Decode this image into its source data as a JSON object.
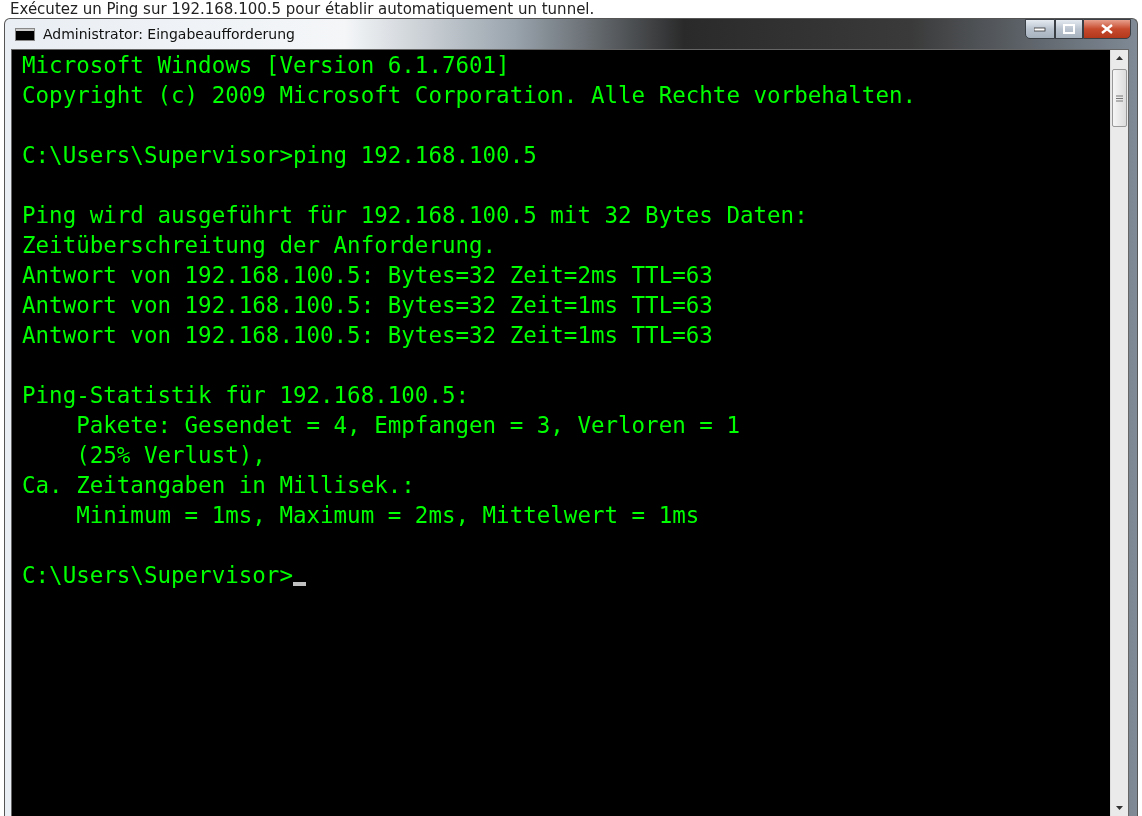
{
  "caption": "Exécutez un Ping sur 192.168.100.5 pour établir automatiquement un tunnel.",
  "window": {
    "title": "Administrator: Eingabeaufforderung",
    "controls": [
      {
        "kind": "minimize"
      },
      {
        "kind": "maximize"
      },
      {
        "kind": "close"
      }
    ]
  },
  "console": {
    "blocks": [
      [
        "Microsoft Windows [Version 6.1.7601]",
        "Copyright (c) 2009 Microsoft Corporation. Alle Rechte vorbehalten."
      ],
      [
        "C:\\Users\\Supervisor>ping 192.168.100.5"
      ],
      [
        "Ping wird ausgeführt für 192.168.100.5 mit 32 Bytes Daten:",
        "Zeitüberschreitung der Anforderung.",
        "Antwort von 192.168.100.5: Bytes=32 Zeit=2ms TTL=63",
        "Antwort von 192.168.100.5: Bytes=32 Zeit=1ms TTL=63",
        "Antwort von 192.168.100.5: Bytes=32 Zeit=1ms TTL=63"
      ],
      [
        "Ping-Statistik für 192.168.100.5:",
        "    Pakete: Gesendet = 4, Empfangen = 3, Verloren = 1",
        "    (25% Verlust),",
        "Ca. Zeitangaben in Millisek.:",
        "    Minimum = 1ms, Maximum = 2ms, Mittelwert = 1ms"
      ],
      [
        "C:\\Users\\Supervisor>"
      ]
    ],
    "cursor": true
  }
}
